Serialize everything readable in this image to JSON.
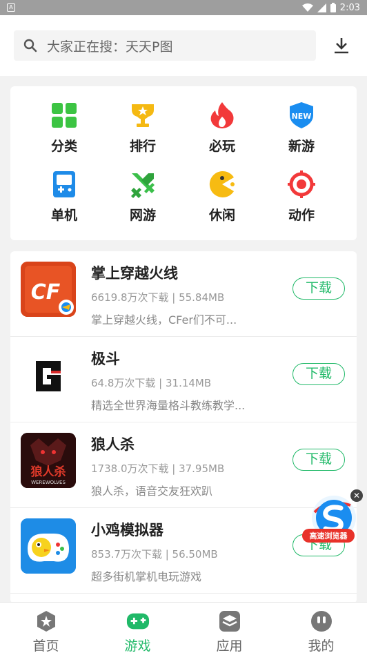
{
  "status_bar": {
    "time": "2:03"
  },
  "search": {
    "placeholder": "大家正在搜：天天P图"
  },
  "categories": [
    {
      "label": "分类",
      "icon": "grid-icon"
    },
    {
      "label": "排行",
      "icon": "trophy-icon"
    },
    {
      "label": "必玩",
      "icon": "flame-icon"
    },
    {
      "label": "新游",
      "icon": "new-badge-icon"
    },
    {
      "label": "单机",
      "icon": "handheld-icon"
    },
    {
      "label": "网游",
      "icon": "swords-icon"
    },
    {
      "label": "休闲",
      "icon": "pacman-icon"
    },
    {
      "label": "动作",
      "icon": "target-icon"
    }
  ],
  "new_badge_text": "NEW",
  "apps": [
    {
      "name": "掌上穿越火线",
      "meta": "6619.8万次下载 | 55.84MB",
      "desc": "掌上穿越火线，CFer们不可...",
      "button": "下载",
      "icon_text": "CF"
    },
    {
      "name": "极斗",
      "meta": "64.8万次下载 | 31.14MB",
      "desc": "精选全世界海量格斗教练教学...",
      "button": "下载",
      "icon_text": "G"
    },
    {
      "name": "狼人杀",
      "meta": "1738.0万次下载 | 37.95MB",
      "desc": "狼人杀，语音交友狂欢趴",
      "button": "下载",
      "icon_text": "狼人杀",
      "icon_subtext": "WEREWOLVES"
    },
    {
      "name": "小鸡模拟器",
      "meta": "853.7万次下载 | 56.50MB",
      "desc": "超多街机掌机电玩游戏",
      "button": "下载"
    }
  ],
  "float_ad": {
    "label": "高速浏览器"
  },
  "bottom_nav": [
    {
      "label": "首页",
      "icon": "star-icon",
      "active": false
    },
    {
      "label": "游戏",
      "icon": "gamepad-icon",
      "active": true
    },
    {
      "label": "应用",
      "icon": "layers-icon",
      "active": false
    },
    {
      "label": "我的",
      "icon": "face-icon",
      "active": false
    }
  ],
  "colors": {
    "accent": "#20b968",
    "header_bg": "#ffffff",
    "status_bar": "#9e9e9e"
  }
}
